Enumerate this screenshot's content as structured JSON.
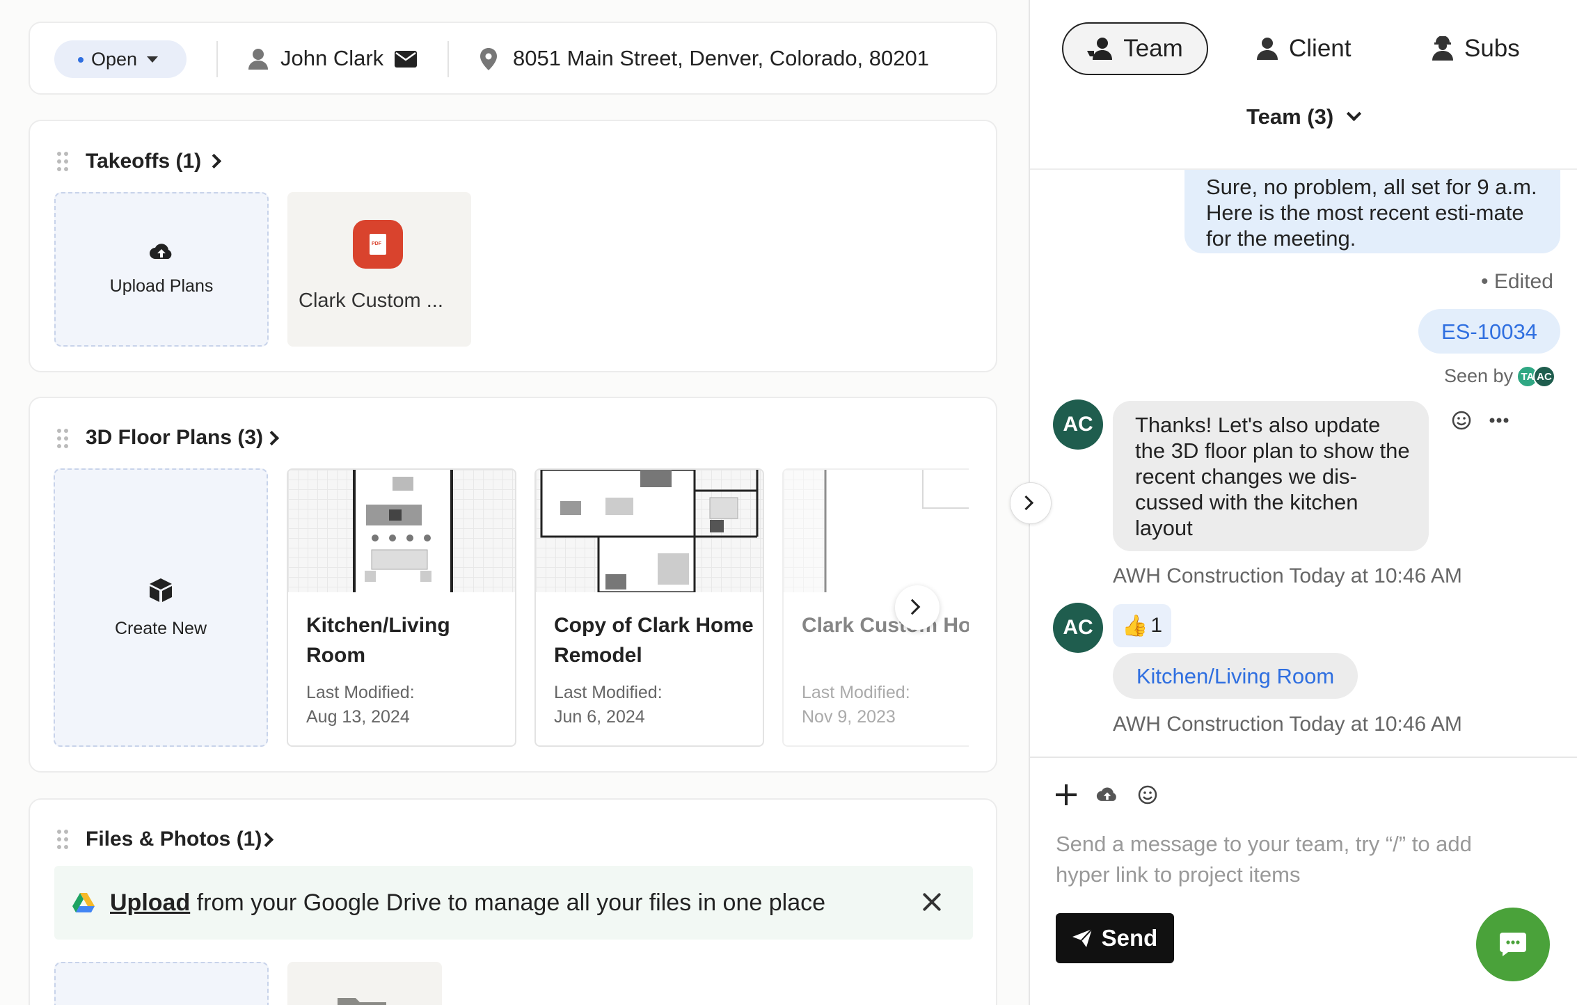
{
  "header": {
    "status": "Open",
    "client_name": "John Clark",
    "address": "8051 Main Street, Denver, Colorado, 80201"
  },
  "takeoffs": {
    "title": "Takeoffs (1)",
    "upload_label": "Upload Plans",
    "files": [
      {
        "name": "Clark Custom ...",
        "icon": "pdf-icon",
        "badge": "PDF"
      }
    ]
  },
  "floor_plans": {
    "title": "3D Floor Plans (3)",
    "create_label": "Create New",
    "items": [
      {
        "title": "Kitchen/Living Room",
        "meta_label": "Last Modified:",
        "date": "Aug 13, 2024"
      },
      {
        "title": "Copy of Clark Home Remodel",
        "meta_label": "Last Modified:",
        "date": "Jun 6, 2024"
      },
      {
        "title": "Clark Custom Home",
        "meta_label": "Last Modified:",
        "date": "Nov 9, 2023"
      }
    ]
  },
  "files_photos": {
    "title": "Files & Photos (1)",
    "banner_link": "Upload",
    "banner_text": "from your Google Drive to manage all your files in one place"
  },
  "chat": {
    "tabs": [
      {
        "label": "Team",
        "icon": "team-icon",
        "active": true
      },
      {
        "label": "Client",
        "icon": "client-icon",
        "active": false
      },
      {
        "label": "Subs",
        "icon": "subs-icon",
        "active": false
      }
    ],
    "team_select": "Team (3)",
    "messages": {
      "out_1": "Sure, no problem, all set for 9 a.m. Here is the most recent esti-mate for the meeting.",
      "edited": "• Edited",
      "out_2_link": "ES-10034",
      "seen_by": "Seen by",
      "seen_avatars": [
        "TA",
        "AC"
      ],
      "in_1_initials": "AC",
      "in_1": "Thanks! Let's also update the 3D floor plan to show the recent changes we dis-cussed with the kitchen layout",
      "in_1_meta": "AWH Construction Today at 10:46 AM",
      "in_2_initials": "AC",
      "in_2_reaction": "👍",
      "in_2_reaction_count": "1",
      "in_2_link": "Kitchen/Living Room",
      "in_2_meta": "AWH Construction Today at 10:46 AM"
    },
    "compose": {
      "placeholder": "Send a message to your team, try “/” to add hyper link to project items",
      "send_label": "Send"
    }
  },
  "colors": {
    "accent_blue": "#2f6fe0",
    "avatar_green": "#1f5d4e",
    "fab_green": "#4aa23a",
    "pdf_red": "#d9432d"
  }
}
